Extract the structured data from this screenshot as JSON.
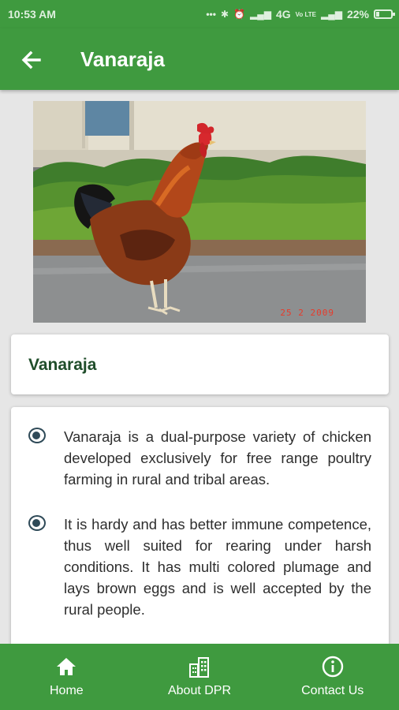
{
  "status": {
    "time": "10:53 AM",
    "network": "4G",
    "network2": "Vo LTE",
    "battery": "22%",
    "battery_level": 0.22
  },
  "appbar": {
    "title": "Vanaraja"
  },
  "photo": {
    "date_stamp": "25  2 2009"
  },
  "card": {
    "title": "Vanaraja"
  },
  "description": {
    "bullets": [
      "Vanaraja is a dual-purpose  variety of chicken developed exclusively for free range poultry farming in rural and tribal areas.",
      "It is hardy and has better  immune competence, thus  well suited  for rearing under harsh conditions. It has multi colored plumage and lays brown eggs and is well accepted  by the rural people."
    ]
  },
  "nav": {
    "home": "Home",
    "about": "About DPR",
    "contact": "Contact Us"
  },
  "colors": {
    "primary": "#3f9a3f",
    "title_text": "#1f4d2a",
    "bullet": "#2f4a58"
  }
}
